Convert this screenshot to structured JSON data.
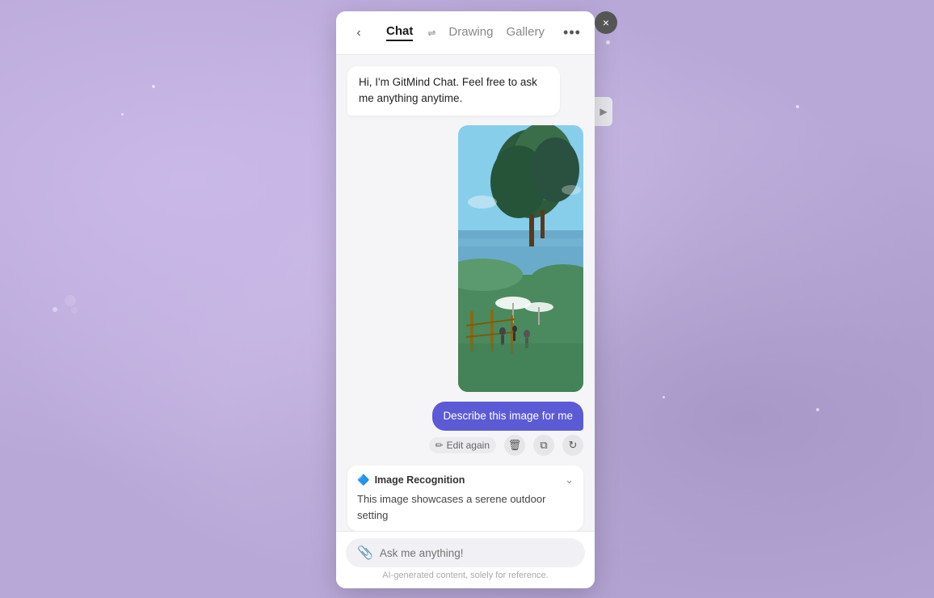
{
  "background": {
    "color": "#b8a8d8"
  },
  "close_button": {
    "label": "×"
  },
  "expand_button": {
    "label": "▶"
  },
  "header": {
    "back_label": "‹",
    "tabs": [
      {
        "id": "chat",
        "label": "Chat",
        "active": true
      },
      {
        "id": "drawing",
        "label": "Drawing",
        "active": false
      },
      {
        "id": "gallery",
        "label": "Gallery",
        "active": false
      }
    ],
    "swap_icon": "⇌",
    "more_icon": "···"
  },
  "chat": {
    "bot_greeting": "Hi, I'm GitMind Chat. Feel free to ask me anything anytime.",
    "user_message": "Describe this image for me",
    "edit_again_label": "Edit again",
    "ai_response_label": "Image Recognition",
    "ai_response_text": "This image showcases a serene outdoor setting",
    "input_placeholder": "Ask me anything!",
    "disclaimer": "AI-generated content, solely for reference."
  },
  "icons": {
    "attach": "📎",
    "edit": "✏️",
    "delete": "🗑",
    "copy": "⧉",
    "refresh": "↻",
    "ai_icon": "🔷"
  }
}
